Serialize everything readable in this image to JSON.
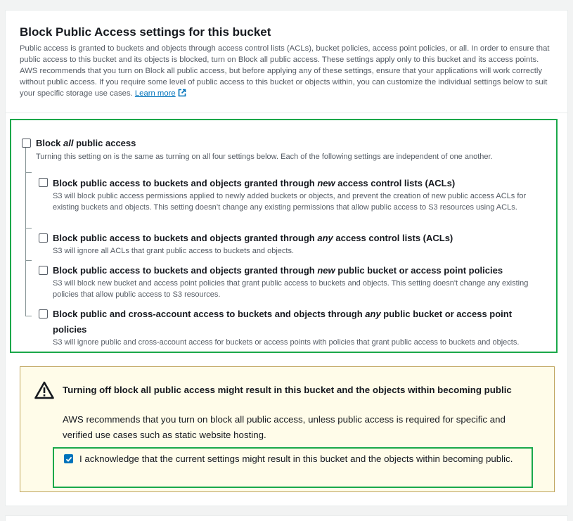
{
  "section": {
    "title": "Block Public Access settings for this bucket",
    "description": "Public access is granted to buckets and objects through access control lists (ACLs), bucket policies, access point policies, or all. In order to ensure that public access to this bucket and its objects is blocked, turn on Block all public access. These settings apply only to this bucket and its access points. AWS recommends that you turn on Block all public access, but before applying any of these settings, ensure that your applications will work correctly without public access. If you require some level of public access to this bucket or objects within, you can customize the individual settings below to suit your specific storage use cases.",
    "learn_more": "Learn more"
  },
  "block_all": {
    "label_pre": "Block ",
    "label_em": "all",
    "label_post": " public access",
    "description": "Turning this setting on is the same as turning on all four settings below. Each of the following settings are independent of one another.",
    "checked": false
  },
  "options": [
    {
      "label_pre": "Block public access to buckets and objects granted through ",
      "label_em": "new",
      "label_post": " access control lists (ACLs)",
      "description": "S3 will block public access permissions applied to newly added buckets or objects, and prevent the creation of new public access ACLs for existing buckets and objects. This setting doesn’t change any existing permissions that allow public access to S3 resources using ACLs.",
      "checked": false
    },
    {
      "label_pre": "Block public access to buckets and objects granted through ",
      "label_em": "any",
      "label_post": " access control lists (ACLs)",
      "description": "S3 will ignore all ACLs that grant public access to buckets and objects.",
      "checked": false
    },
    {
      "label_pre": "Block public access to buckets and objects granted through ",
      "label_em": "new",
      "label_post": " public bucket or access point policies",
      "description": "S3 will block new bucket and access point policies that grant public access to buckets and objects. This setting doesn't change any existing policies that allow public access to S3 resources.",
      "checked": false
    },
    {
      "label_pre": "Block public and cross-account access to buckets and objects through ",
      "label_em": "any",
      "label_post": " public bucket or access point",
      "label_line2": "policies",
      "description": "S3 will ignore public and cross-account access for buckets or access points with policies that grant public access to buckets and objects.",
      "checked": false
    }
  ],
  "warning": {
    "title": "Turning off block all public access might result in this bucket and the objects within becoming public",
    "text": "AWS recommends that you turn on block all public access, unless public access is required for specific and verified use cases such as static website hosting.",
    "acknowledge": "I acknowledge that the current settings might result in this bucket and the objects within becoming public.",
    "acknowledge_checked": true
  },
  "colors": {
    "highlight": "#1aa84a",
    "link": "#0073bb",
    "warning_bg": "#fffce9",
    "warning_border": "#bfa45b",
    "checkbox_checked": "#0073bb"
  }
}
